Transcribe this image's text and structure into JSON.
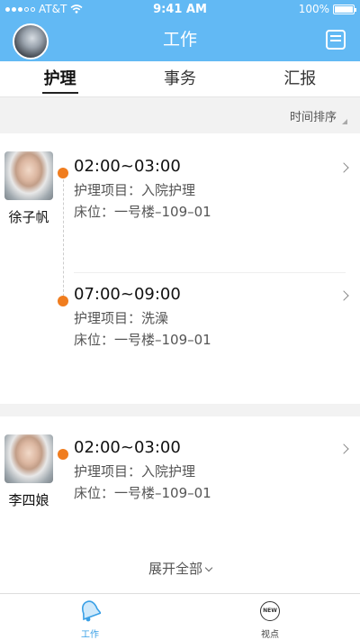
{
  "status_bar": {
    "carrier": "AT&T",
    "time": "9:41 AM",
    "battery": "100%",
    "battery_level": 1.0
  },
  "nav": {
    "title": "工作",
    "avatar": "user-avatar",
    "right_icon": "notebook-icon"
  },
  "tabs": [
    {
      "label": "护理",
      "active": true
    },
    {
      "label": "事务",
      "active": false
    },
    {
      "label": "汇报",
      "active": false
    }
  ],
  "sort": {
    "label": "时间排序"
  },
  "patients": [
    {
      "name": "徐子帆",
      "entries": [
        {
          "time": "02:00~03:00",
          "item": "护理项目：入院护理",
          "bed": "床位：一号楼–109–01"
        },
        {
          "time": "07:00~09:00",
          "item": "护理项目：洗澡",
          "bed": "床位：一号楼–109–01"
        }
      ]
    },
    {
      "name": "李四娘",
      "entries": [
        {
          "time": "02:00~03:00",
          "item": "护理项目：入院护理",
          "bed": "床位：一号楼–109–01"
        }
      ]
    }
  ],
  "expand_label": "展开全部",
  "bottom_tabs": [
    {
      "label": "工作",
      "icon": "bell-icon",
      "active": true
    },
    {
      "label": "视点",
      "icon": "new-badge-icon",
      "badge_text": "NEW",
      "active": false
    }
  ],
  "colors": {
    "primary": "#62b9f4",
    "accent_dot": "#f07d1f",
    "active_tab_label": "#3aa0e6"
  }
}
